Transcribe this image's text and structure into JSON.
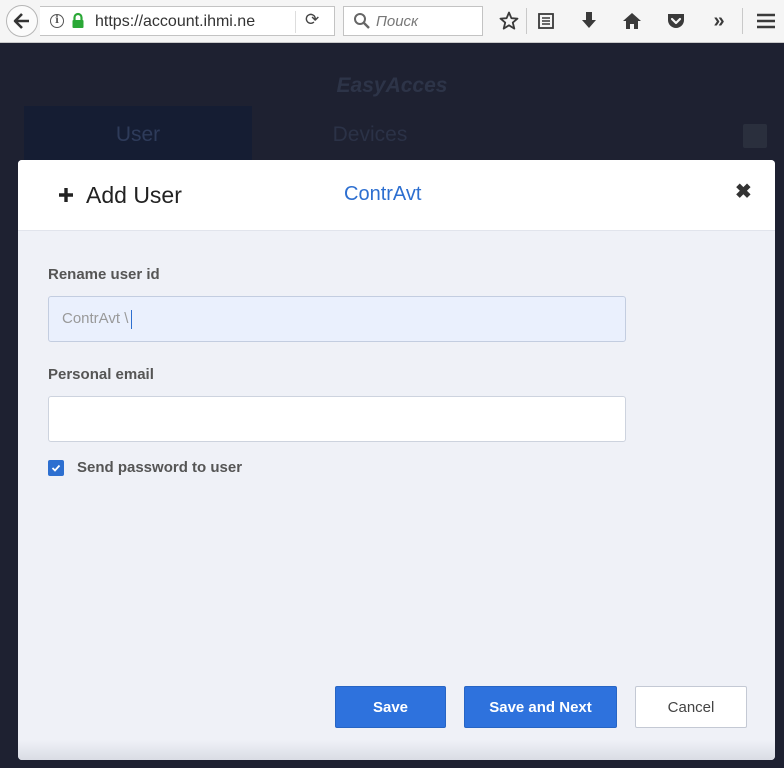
{
  "browser": {
    "url": "https://account.ihmi.ne",
    "search_placeholder": "Поиск",
    "toolbar_icons": [
      "back-arrow-icon",
      "info-icon",
      "lock-icon",
      "reload-icon",
      "search-icon",
      "star-icon",
      "reading-list-icon",
      "download-icon",
      "home-icon",
      "pocket-icon",
      "overflow-chevron-icon",
      "hamburger-menu-icon"
    ]
  },
  "app": {
    "title": "EasyAcces",
    "tabs": [
      "User",
      "Devices"
    ]
  },
  "modal": {
    "title": "Add User",
    "user_name": "ContrAvt",
    "close_symbol": "✖",
    "fields": {
      "rename_label": "Rename user id",
      "rename_value": "ContrAvt \\",
      "email_label": "Personal email",
      "email_value": ""
    },
    "send_password_label": "Send password to user",
    "send_password_checked": true,
    "buttons": {
      "save": "Save",
      "save_next": "Save and Next",
      "cancel": "Cancel"
    }
  },
  "colors": {
    "accent": "#2e72dd",
    "backdrop": "#1e2131",
    "modal_bg": "#eff1f7"
  }
}
